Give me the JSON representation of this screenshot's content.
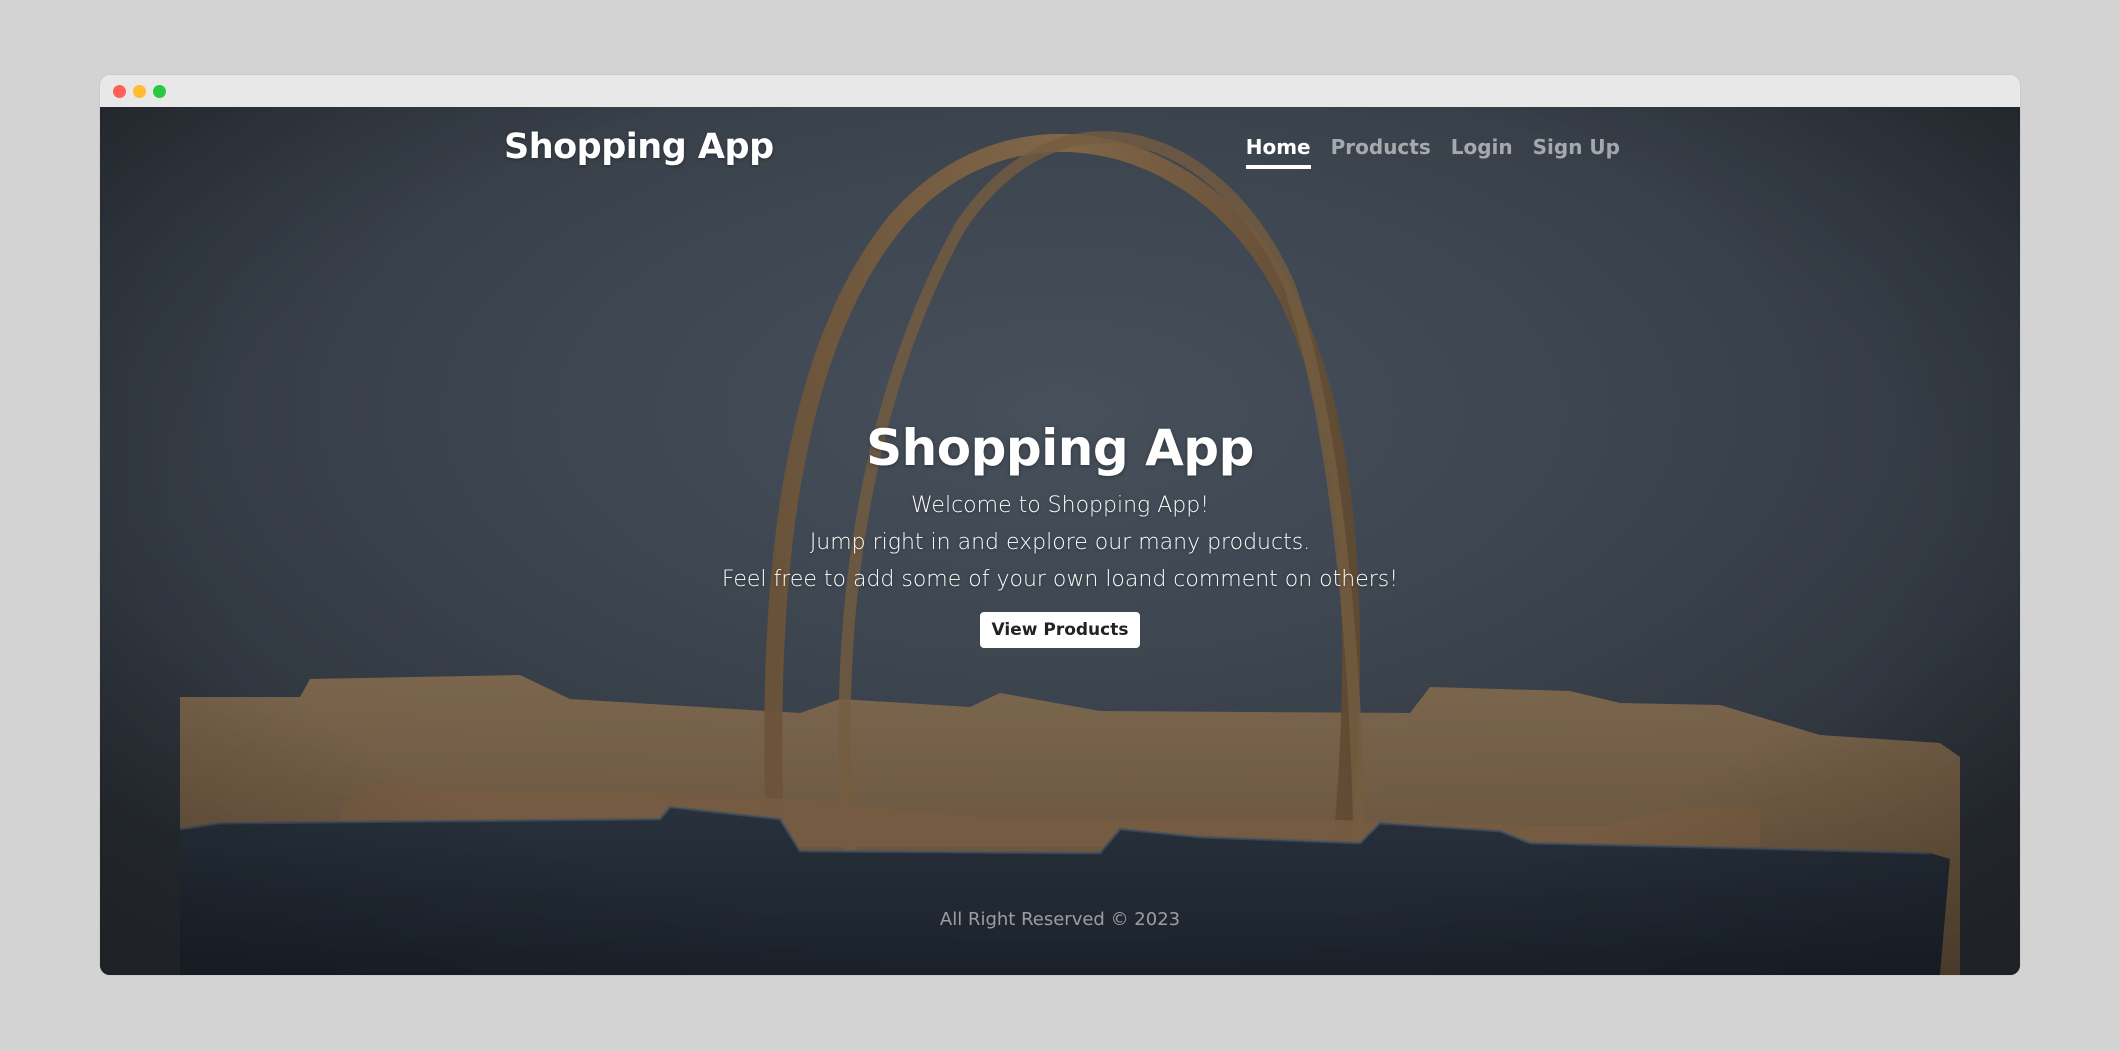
{
  "window": {
    "controls": [
      "close",
      "minimize",
      "maximize"
    ],
    "colors": {
      "close": "#ff5f57",
      "minimize": "#febc2e",
      "maximize": "#28c840"
    }
  },
  "navbar": {
    "brand": "Shopping App",
    "links": [
      {
        "label": "Home",
        "active": true
      },
      {
        "label": "Products",
        "active": false
      },
      {
        "label": "Login",
        "active": false
      },
      {
        "label": "Sign Up",
        "active": false
      }
    ]
  },
  "hero": {
    "title": "Shopping App",
    "lines": [
      "Welcome to Shopping App!",
      "Jump right in and explore our many products.",
      "Feel free to add some of your own loand comment on others!"
    ],
    "cta_label": "View Products"
  },
  "footer": {
    "text": "All Right Reserved © 2023"
  },
  "background": {
    "image_description_icon": "shopping-bag-photo",
    "colors": {
      "wall": "#4c5663",
      "bag_paper": "#a8845a",
      "bag_denim": "#2a3442"
    }
  }
}
